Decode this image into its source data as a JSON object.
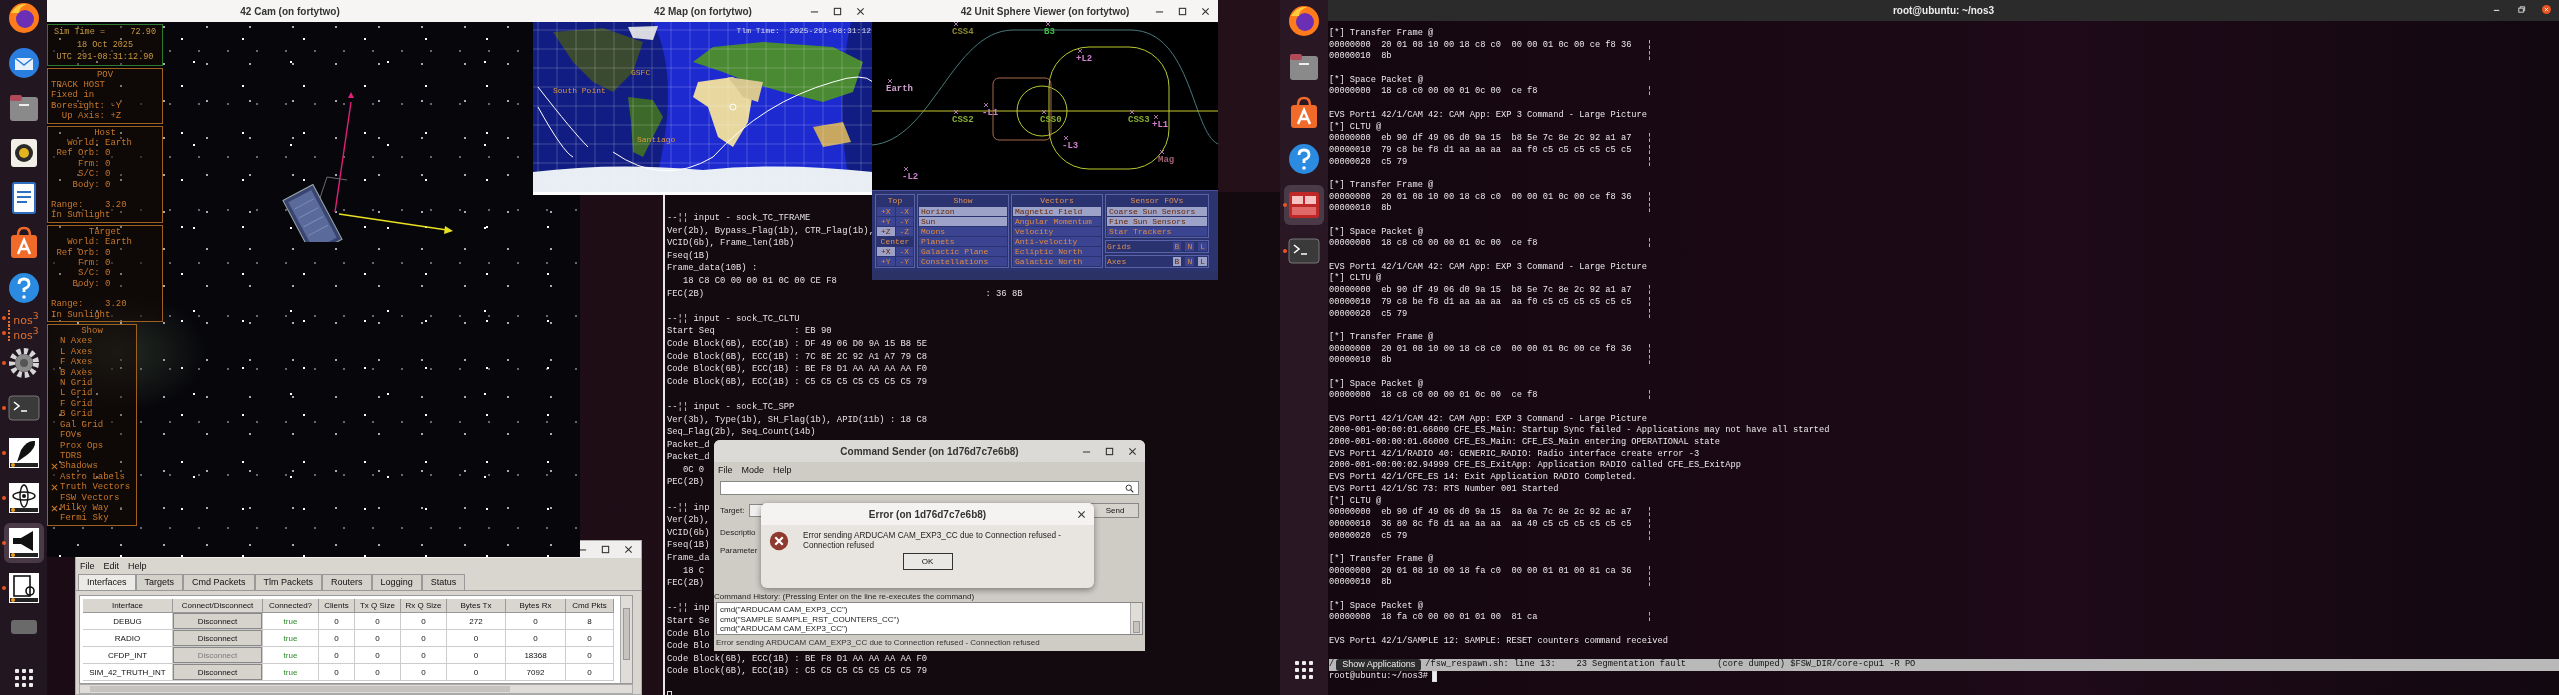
{
  "left_dock": {
    "items": [
      {
        "running": false,
        "selected": false
      },
      {
        "running": false,
        "selected": false
      },
      {
        "running": false,
        "selected": false
      },
      {
        "running": false,
        "selected": false
      },
      {
        "running": false,
        "selected": false
      },
      {
        "running": false,
        "selected": false
      },
      {
        "running": false,
        "selected": false
      },
      {
        "running": true,
        "selected": false,
        "label": "nos$^{3}$"
      },
      {
        "running": true,
        "selected": false,
        "label": "nos$^{3}$"
      },
      {
        "running": true,
        "selected": false
      },
      {
        "running": true,
        "selected": false
      },
      {
        "running": true,
        "selected": false
      },
      {
        "running": true,
        "selected": false
      },
      {
        "running": true,
        "selected": true
      },
      {
        "running": true,
        "selected": false
      },
      {
        "running": false,
        "selected": false
      },
      {
        "running": false,
        "selected": false
      }
    ]
  },
  "cam_window": {
    "title": "42 Cam (on fortytwo)",
    "time_box": [
      "Sim Time =     72.90",
      "18 Oct 2025",
      "UTC 291-08:31:12.90"
    ],
    "pov": {
      "heading": "POV",
      "lines": [
        "TRACK HOST",
        "Fixed in",
        "Boresight: -Y",
        "  Up Axis: +Z"
      ]
    },
    "host": {
      "heading": "Host",
      "lines": [
        "   World: Earth",
        " Ref Orb: 0",
        "     Frm: 0",
        "     S/C: 0",
        "    Body: 0"
      ],
      "range": "Range:    3.20",
      "sun": "In Sunlight"
    },
    "target": {
      "heading": "Target",
      "lines": [
        "   World: Earth",
        " Ref Orb: 0",
        "     Frm: 0",
        "     S/C: 0",
        "    Body: 0"
      ],
      "range": "Range:    3.20",
      "sun": "In Sunlight"
    },
    "show": {
      "heading": "Show",
      "items": [
        {
          "label": "N Axes",
          "checked": false
        },
        {
          "label": "L Axes",
          "checked": false
        },
        {
          "label": "F Axes",
          "checked": false
        },
        {
          "label": "B Axes",
          "checked": false
        },
        {
          "label": "N Grid",
          "checked": false
        },
        {
          "label": "L Grid",
          "checked": false
        },
        {
          "label": "F Grid",
          "checked": false
        },
        {
          "label": "B Grid",
          "checked": false
        },
        {
          "label": "Gal Grid",
          "checked": false
        },
        {
          "label": "FOVs",
          "checked": false
        },
        {
          "label": "Prox Ops",
          "checked": false
        },
        {
          "label": "TDRS",
          "checked": false
        },
        {
          "label": "Shadows",
          "checked": true
        },
        {
          "label": "Astro Labels",
          "checked": false
        },
        {
          "label": "Truth Vectors",
          "checked": true
        },
        {
          "label": "FSW Vectors",
          "checked": false
        },
        {
          "label": "Milky Way",
          "checked": true
        },
        {
          "label": "Fermi Sky",
          "checked": false
        }
      ]
    }
  },
  "map_window": {
    "title": "42 Map (on fortytwo)",
    "tlm_time": "Tlm Time:  2025-291-08:31:12",
    "sites": [
      "GSFC",
      "South Point",
      "Santiago"
    ]
  },
  "sphere_window": {
    "title": "42 Unit Sphere Viewer (on fortytwo)",
    "labels": [
      {
        "text": "CSS4",
        "color": "#8a8a30"
      },
      {
        "text": "B3",
        "color": "#40c040"
      },
      {
        "text": "+L2",
        "color": "#d080d0"
      },
      {
        "text": "Earth",
        "color": "#d0a0d0"
      },
      {
        "text": "CSS2",
        "color": "#8ab030"
      },
      {
        "text": "-L1",
        "color": "#d080d0"
      },
      {
        "text": "CSS0",
        "color": "#8ab030"
      },
      {
        "text": "CSS3",
        "color": "#8ab030"
      },
      {
        "text": "+L1",
        "color": "#d080d0"
      },
      {
        "text": "-L3",
        "color": "#d080d0"
      },
      {
        "text": "Mag",
        "color": "#a06070"
      },
      {
        "text": "-L2",
        "color": "#d080d0"
      }
    ],
    "panel": {
      "top_heading": "Top",
      "top_buttons": [
        {
          "label": "+X",
          "selected": false
        },
        {
          "label": "-X",
          "selected": false
        },
        {
          "label": "+Y",
          "selected": false
        },
        {
          "label": "-Y",
          "selected": false
        },
        {
          "label": "+Z",
          "selected": true
        },
        {
          "label": "-Z",
          "selected": false
        }
      ],
      "center_label": "Center",
      "center_buttons": [
        {
          "label": "+X",
          "selected": true
        },
        {
          "label": "-X",
          "selected": false
        },
        {
          "label": "+Y",
          "selected": false
        },
        {
          "label": "-Y",
          "selected": false
        }
      ],
      "columns": [
        {
          "heading": "Show",
          "items": [
            {
              "label": "Horizon",
              "selected": true
            },
            {
              "label": "Sun",
              "selected": true
            },
            {
              "label": "Moons",
              "selected": false
            },
            {
              "label": "Planets",
              "selected": false
            },
            {
              "label": "Galactic Plane",
              "selected": false
            },
            {
              "label": "Constellations",
              "selected": false
            }
          ]
        },
        {
          "heading": "Vectors",
          "items": [
            {
              "label": "Magnetic Field",
              "selected": true
            },
            {
              "label": "Angular Momentum",
              "selected": false
            },
            {
              "label": "Velocity",
              "selected": false
            },
            {
              "label": "Anti-velocity",
              "selected": false
            },
            {
              "label": "Ecliptic North",
              "selected": false
            },
            {
              "label": "Galactic North",
              "selected": false
            }
          ]
        }
      ],
      "fov": {
        "heading": "Sensor FOVs",
        "items": [
          {
            "label": "Coarse Sun Sensors",
            "selected": true
          },
          {
            "label": "Fine Sun Sensors",
            "selected": true
          },
          {
            "label": "Star Trackers",
            "selected": false
          }
        ]
      },
      "toggle_rows": [
        {
          "label": "Grids",
          "toggles": [
            {
              "label": "B",
              "selected": false
            },
            {
              "label": "N",
              "selected": false
            },
            {
              "label": "L",
              "selected": false
            }
          ]
        },
        {
          "label": "Axes",
          "toggles": [
            {
              "label": "B",
              "selected": true
            },
            {
              "label": "N",
              "selected": false
            },
            {
              "label": "L",
              "selected": true
            }
          ]
        }
      ]
    }
  },
  "middle_terminal": {
    "blocks": [
      [
        {
          "text": "--¦¦ input - sock_TC_TFRAME"
        },
        {
          "text": "Ver(2b), Bypass_Flag(1b), CTR_Flag(1b),"
        },
        {
          "text": "VCID(6b), Frame_len(10b)"
        },
        {
          "text": "Fseq(1B)"
        },
        {
          "text": "Frame_data(10B) :"
        },
        {
          "text": "   18 C8 C0 00 00 01 0C 00 CE F8"
        },
        {
          "text": "FEC(2B)",
          "value": ": 36 8B"
        }
      ],
      [
        {
          "text": "--¦¦ input - sock_TC_CLTU"
        },
        {
          "text": "Start Seq               : EB 90"
        },
        {
          "text": "Code Block(6B), ECC(1B) : DF 49 06 D0 9A 15 B8 5E"
        },
        {
          "text": "Code Block(6B), ECC(1B) : 7C 8E 2C 92 A1 A7 79 C8"
        },
        {
          "text": "Code Block(6B), ECC(1B) : BE F8 D1 AA AA AA AA F0"
        },
        {
          "text": "Code Block(6B), ECC(1B) : C5 C5 C5 C5 C5 C5 C5 79"
        }
      ],
      [
        {
          "text": "--¦¦ input - sock_TC_SPP"
        },
        {
          "text": "Ver(3b), Type(1b), SH_Flag(1b), APID(11b) : 18 C8"
        },
        {
          "text": "Seq_Flag(2b), Seq_Count(14b)"
        },
        {
          "text": "Packet_d"
        },
        {
          "text": "Packet_d"
        },
        {
          "text": "   0C 0"
        },
        {
          "text": "PEC(2B)"
        }
      ],
      [
        {
          "text": "--¦¦ inp"
        },
        {
          "text": "Ver(2b),"
        },
        {
          "text": "VCID(6b)"
        },
        {
          "text": "Fseq(1B)"
        },
        {
          "text": "Frame_da"
        },
        {
          "text": "   18 C"
        },
        {
          "text": "FEC(2B)"
        }
      ],
      [
        {
          "text": "--¦¦ inp"
        },
        {
          "text": "Start Se"
        },
        {
          "text": "Code Blo"
        },
        {
          "text": "Code Blo"
        },
        {
          "text": "Code Block(6B), ECC(1B) : BE F8 D1 AA AA AA AA F0"
        },
        {
          "text": "Code Block(6B), ECC(1B) : C5 C5 C5 C5 C5 C5 C5 79"
        }
      ]
    ]
  },
  "command_sender": {
    "title": "Command Sender (on 1d76d7c7e6b8)",
    "menu": [
      "File",
      "Mode",
      "Help"
    ],
    "target_label": "Target:",
    "send": "Send",
    "description_label": "Descriptio",
    "parameters_label": "Parameter",
    "history_label": "Command History: (Pressing Enter on the line re-executes the command)",
    "history": [
      "cmd(\"ARDUCAM CAM_EXP3_CC\")",
      "cmd(\"SAMPLE SAMPLE_RST_COUNTERS_CC\")",
      "cmd(\"ARDUCAM CAM_EXP3_CC\")"
    ],
    "status": "Error sending ARDUCAM CAM_EXP3_CC due to Connection refused - Connection refused"
  },
  "error_dialog": {
    "title": "Error (on 1d76d7c7e6b8)",
    "message": "Error sending ARDUCAM CAM_EXP3_CC due to Connection refused - Connection refused",
    "button": "OK"
  },
  "server_window": {
    "menu": [
      "File",
      "Edit",
      "Help"
    ],
    "tabs": [
      {
        "label": "Interfaces",
        "selected": true
      },
      {
        "label": "Targets",
        "selected": false
      },
      {
        "label": "Cmd Packets",
        "selected": false
      },
      {
        "label": "Tlm Packets",
        "selected": false
      },
      {
        "label": "Routers",
        "selected": false
      },
      {
        "label": "Logging",
        "selected": false
      },
      {
        "label": "Status",
        "selected": false
      }
    ],
    "table": {
      "columns": [
        "Interface",
        "Connect/Disconnect",
        "Connected?",
        "Clients",
        "Tx Q Size",
        "Rx Q Size",
        "Bytes Tx",
        "Bytes Rx",
        "Cmd Pkts"
      ],
      "rows": [
        {
          "disabled": false,
          "cells": [
            "DEBUG",
            "Disconnect",
            "true",
            "0",
            "0",
            "0",
            "272",
            "0",
            "8"
          ]
        },
        {
          "disabled": false,
          "cells": [
            "RADIO",
            "Disconnect",
            "true",
            "0",
            "0",
            "0",
            "0",
            "0",
            "0"
          ]
        },
        {
          "disabled": true,
          "cells": [
            "CFDP_INT",
            "Disconnect",
            "true",
            "0",
            "0",
            "0",
            "0",
            "18368",
            "0"
          ]
        },
        {
          "disabled": false,
          "cells": [
            "SIM_42_TRUTH_INT",
            "Disconnect",
            "true",
            "0",
            "0",
            "0",
            "0",
            "7092",
            "0"
          ]
        }
      ]
    }
  },
  "right_dock": {
    "items": [
      {
        "running": false,
        "selected": false
      },
      {
        "running": false,
        "selected": false
      },
      {
        "running": false,
        "selected": false
      },
      {
        "running": false,
        "selected": false
      },
      {
        "running": true,
        "selected": true
      },
      {
        "running": true,
        "selected": false
      }
    ],
    "tooltip": "Show Applications"
  },
  "right_terminal": {
    "title": "root@ubuntu: ~/nos3",
    "blocks": [
      [
        {
          "text": "[*] Transfer Frame @"
        },
        {
          "text": "00000000  20 01 08 10 00 18 c8 c0  00 00 01 0c 00 ce f8 36",
          "edge": "¦"
        },
        {
          "text": "00000010  8b",
          "edge": "¦"
        }
      ],
      [
        {
          "text": "[*] Space Packet @"
        },
        {
          "text": "00000000  18 c8 c0 00 00 01 0c 00  ce f8",
          "edge": "¦"
        }
      ],
      [
        {
          "text": "EVS Port1 42/1/CAM 42: CAM App: EXP 3 Command - Large Picture"
        },
        {
          "text": "[*] CLTU @"
        },
        {
          "text": "00000000  eb 90 df 49 06 d0 9a 15  b8 5e 7c 8e 2c 92 a1 a7",
          "edge": "¦"
        },
        {
          "text": "00000010  79 c8 be f8 d1 aa aa aa  aa f0 c5 c5 c5 c5 c5 c5",
          "edge": "¦"
        },
        {
          "text": "00000020  c5 79",
          "edge": "¦"
        }
      ],
      [
        {
          "text": "[*] Transfer Frame @"
        },
        {
          "text": "00000000  20 01 08 10 00 18 c8 c0  00 00 01 0c 00 ce f8 36",
          "edge": "¦"
        },
        {
          "text": "00000010  8b",
          "edge": "¦"
        }
      ],
      [
        {
          "text": "[*] Space Packet @"
        },
        {
          "text": "00000000  18 c8 c0 00 00 01 0c 00  ce f8",
          "edge": "¦"
        }
      ],
      [
        {
          "text": "EVS Port1 42/1/CAM 42: CAM App: EXP 3 Command - Large Picture"
        },
        {
          "text": "[*] CLTU @"
        },
        {
          "text": "00000000  eb 90 df 49 06 d0 9a 15  b8 5e 7c 8e 2c 92 a1 a7",
          "edge": "¦"
        },
        {
          "text": "00000010  79 c8 be f8 d1 aa aa aa  aa f0 c5 c5 c5 c5 c5 c5",
          "edge": "¦"
        },
        {
          "text": "00000020  c5 79",
          "edge": "¦"
        }
      ],
      [
        {
          "text": "[*] Transfer Frame @"
        },
        {
          "text": "00000000  20 01 08 10 00 18 c8 c0  00 00 01 0c 00 ce f8 36",
          "edge": "¦"
        },
        {
          "text": "00000010  8b",
          "edge": "¦"
        }
      ],
      [
        {
          "text": "[*] Space Packet @"
        },
        {
          "text": "00000000  18 c8 c0 00 00 01 0c 00  ce f8",
          "edge": "¦"
        }
      ],
      [
        {
          "text": "EVS Port1 42/1/CAM 42: CAM App: EXP 3 Command - Large Picture"
        },
        {
          "text": "2000-001-00:00:01.66000 CFE_ES_Main: Startup Sync failed - Applications may not have all started"
        },
        {
          "text": "2000-001-00:00:01.66000 CFE_ES_Main: CFE_ES_Main entering OPERATIONAL state"
        },
        {
          "text": "EVS Port1 42/1/RADIO 40: GENERIC_RADIO: Radio interface create error -3"
        },
        {
          "text": "2000-001-00:00:02.94999 CFE_ES_ExitApp: Application RADIO called CFE_ES_ExitApp"
        },
        {
          "text": "EVS Port1 42/1/CFE_ES 14: Exit Application RADIO Completed."
        },
        {
          "text": "EVS Port1 42/1/SC 73: RTS Number 001 Started"
        },
        {
          "text": "[*] CLTU @"
        },
        {
          "text": "00000000  eb 90 df 49 06 d0 9a 15  8a 0a 7c 8e 2c 92 ac a7",
          "edge": "¦"
        },
        {
          "text": "00000010  36 80 8c f8 d1 aa aa aa  aa 40 c5 c5 c5 c5 c5 c5",
          "edge": "¦"
        },
        {
          "text": "00000020  c5 79",
          "edge": "¦"
        }
      ],
      [
        {
          "text": "[*] Transfer Frame @"
        },
        {
          "text": "00000000  20 01 08 10 00 18 fa c0  00 00 01 01 00 81 ca 36",
          "edge": "¦"
        },
        {
          "text": "00000010  8b",
          "edge": "¦"
        }
      ],
      [
        {
          "text": "[*] Space Packet @"
        },
        {
          "text": "00000000  18 fa c0 00 00 01 01 00  81 ca",
          "edge": "¦"
        }
      ],
      [
        {
          "text": "EVS Port1 42/1/SAMPLE 12: SAMPLE: RESET counters command received"
        }
      ]
    ],
    "highlight_line": {
      "lead": "/",
      "text": "/fsw_respawn.sh: line 13:    23 Segmentation fault      (core dumped) $FSW_DIR/core-cpu1 -R PO"
    },
    "prompt": "root@ubuntu:~/nos3#"
  }
}
